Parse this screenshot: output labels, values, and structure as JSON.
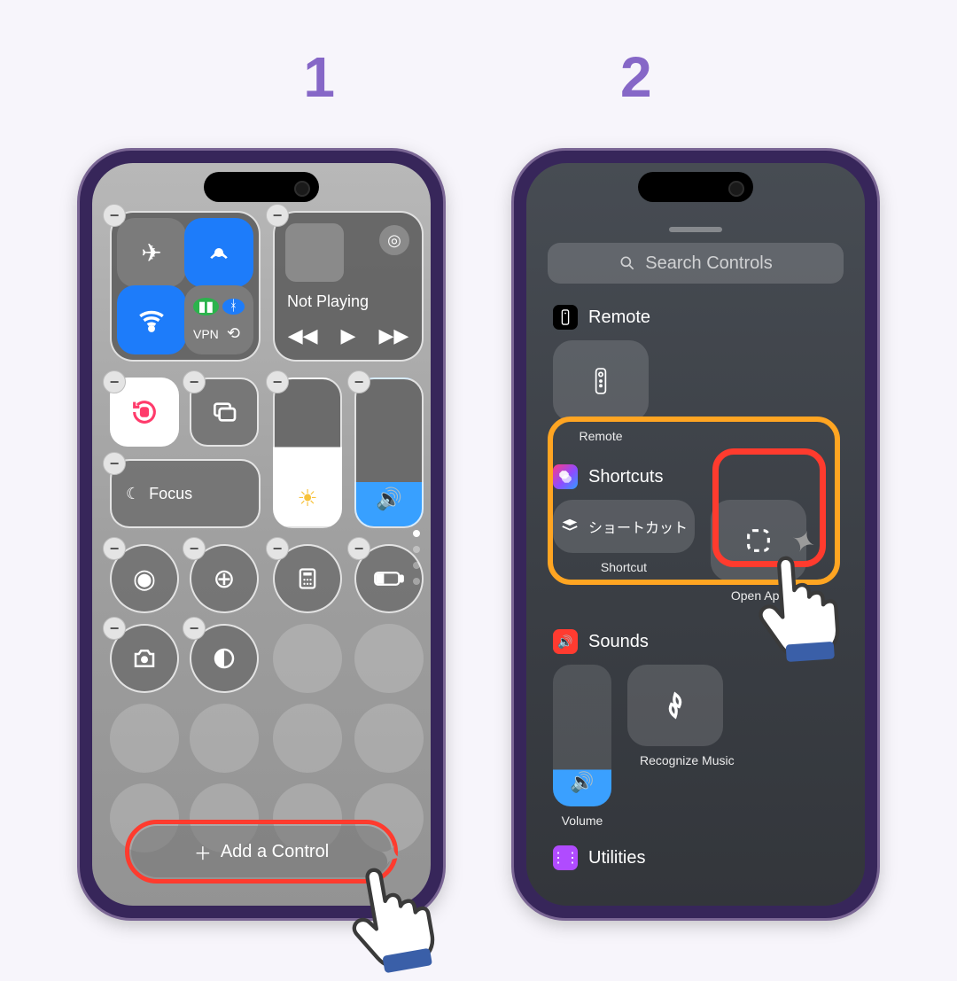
{
  "steps": {
    "one": "1",
    "two": "2"
  },
  "colors": {
    "accent": "#8667c7",
    "red": "#ff3b2e",
    "orange": "#ffa522",
    "blue": "#1d7cfa"
  },
  "left": {
    "media": {
      "title": "Not Playing"
    },
    "focus_label": "Focus",
    "add_control": "Add a Control"
  },
  "right": {
    "search_placeholder": "Search Controls",
    "sections": {
      "remote": {
        "header": "Remote",
        "item_label": "Remote"
      },
      "shortcuts": {
        "header": "Shortcuts",
        "shortcut_text": "ショートカット",
        "shortcut_label": "Shortcut",
        "openapp_label": "Open App"
      },
      "sounds": {
        "header": "Sounds",
        "recognize_label": "Recognize Music",
        "volume_label": "Volume"
      },
      "utilities": {
        "header": "Utilities"
      }
    }
  }
}
